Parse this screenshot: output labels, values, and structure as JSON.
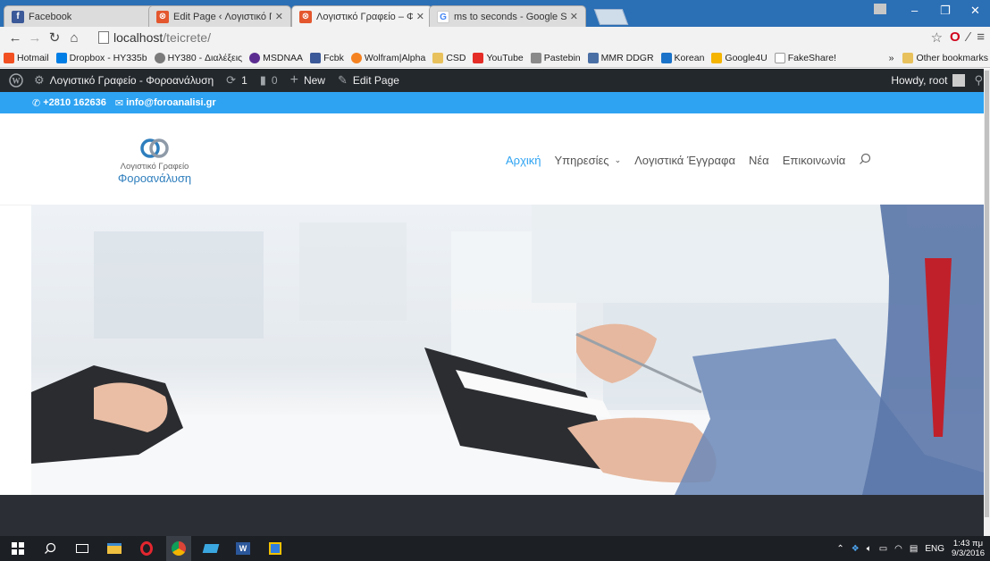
{
  "browser": {
    "tabs": [
      {
        "title": "Facebook",
        "favicon": "facebook-icon",
        "color": "#3b5998",
        "active": false
      },
      {
        "title": "Edit Page ‹ Λογιστικό Γραφ",
        "favicon": "wp-site-icon",
        "color": "#e4572e",
        "active": false
      },
      {
        "title": "Λογιστικό Γραφείο – Φορο",
        "favicon": "wp-site-icon",
        "color": "#e4572e",
        "active": true
      },
      {
        "title": "ms to seconds - Google Se",
        "favicon": "google-icon",
        "color": "#4285f4",
        "active": false
      }
    ],
    "url_host": "localhost",
    "url_path": "/teicrete/",
    "bookmarks": [
      {
        "label": "Hotmail",
        "icon": "windows-icon",
        "color": "#f25022"
      },
      {
        "label": "Dropbox - HY335b",
        "icon": "dropbox-icon",
        "color": "#007ee5"
      },
      {
        "label": "HY380 - Διαλέξεις",
        "icon": "link-icon",
        "color": "#7a7a7a"
      },
      {
        "label": "MSDNAA",
        "icon": "msdn-icon",
        "color": "#5c2d91"
      },
      {
        "label": "Fcbk",
        "icon": "facebook-icon",
        "color": "#3b5998"
      },
      {
        "label": "Wolfram|Alpha",
        "icon": "wolfram-icon",
        "color": "#f58220"
      },
      {
        "label": "CSD",
        "icon": "folder-icon",
        "color": "#e8c15c"
      },
      {
        "label": "YouTube",
        "icon": "youtube-icon",
        "color": "#e52d27"
      },
      {
        "label": "Pastebin",
        "icon": "pastebin-icon",
        "color": "#8a8a8a"
      },
      {
        "label": "MMR DDGR",
        "icon": "mmr-icon",
        "color": "#4a6fa5"
      },
      {
        "label": "Korean",
        "icon": "korean-icon",
        "color": "#1a73c8"
      },
      {
        "label": "Google4U",
        "icon": "google4u-icon",
        "color": "#f4b400"
      },
      {
        "label": "FakeShare!",
        "icon": "page-icon",
        "color": "#9a9a9a"
      }
    ],
    "other_bookmarks": "Other bookmarks",
    "overflow": "»"
  },
  "adminbar": {
    "site_name": "Λογιστικό Γραφείο - Φοροανάλυση",
    "updates": "1",
    "comments": "0",
    "new_label": "New",
    "edit_label": "Edit Page",
    "howdy": "Howdy, root"
  },
  "topbar": {
    "phone": "+2810 162636",
    "email": "info@foroanalisi.gr"
  },
  "logo": {
    "line1": "Λογιστικό Γραφείο",
    "line2": "Φοροανάλυση"
  },
  "nav": {
    "items": [
      {
        "label": "Αρχική",
        "active": true
      },
      {
        "label": "Υπηρεσίες",
        "active": false,
        "dropdown": true
      },
      {
        "label": "Λογιστικά Έγγραφα",
        "active": false
      },
      {
        "label": "Νέα",
        "active": false
      },
      {
        "label": "Επικοινωνία",
        "active": false
      }
    ]
  },
  "taskbar": {
    "language": "ENG",
    "time": "1:43 πμ",
    "date": "9/3/2016"
  },
  "colors": {
    "accent": "#2ea3f2",
    "adminbar": "#23282d",
    "tabstrip": "#2b6fb5"
  }
}
